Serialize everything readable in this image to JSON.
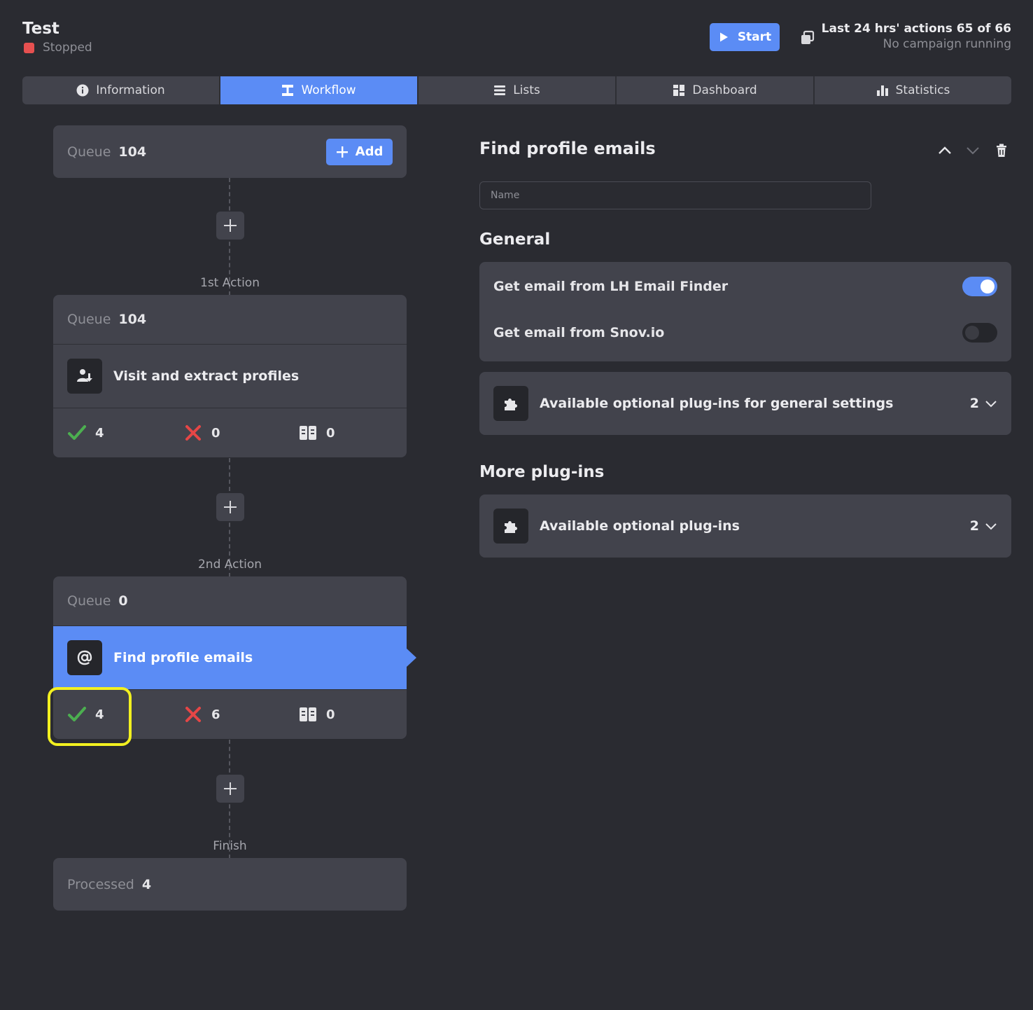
{
  "header": {
    "title": "Test",
    "status": "Stopped",
    "start_label": "Start",
    "actions_line": "Last 24 hrs' actions 65 of 66",
    "campaign_line": "No campaign running"
  },
  "tabs": [
    {
      "label": "Information",
      "icon": "info-icon"
    },
    {
      "label": "Workflow",
      "icon": "workflow-icon",
      "active": true
    },
    {
      "label": "Lists",
      "icon": "list-icon"
    },
    {
      "label": "Dashboard",
      "icon": "dashboard-icon"
    },
    {
      "label": "Statistics",
      "icon": "bar-chart-icon"
    }
  ],
  "workflow": {
    "start": {
      "queue_label": "Queue",
      "queue_count": "104",
      "add_label": "Add"
    },
    "steps": [
      {
        "label": "1st Action",
        "queue_label": "Queue",
        "queue_count": "104",
        "action": "Visit and extract profiles",
        "icon": "user-download-icon",
        "success": "4",
        "failed": "0",
        "skipped": "0"
      },
      {
        "label": "2nd Action",
        "queue_label": "Queue",
        "queue_count": "0",
        "action": "Find profile emails",
        "icon": "at-sign-icon",
        "success": "4",
        "failed": "6",
        "skipped": "0",
        "selected": true
      }
    ],
    "finish": {
      "label": "Finish",
      "processed_label": "Processed",
      "processed_count": "4"
    }
  },
  "panel": {
    "title": "Find profile emails",
    "name_placeholder": "Name",
    "general_heading": "General",
    "toggles": [
      {
        "label": "Get email from LH Email Finder",
        "on": true
      },
      {
        "label": "Get email from Snov.io",
        "on": false
      }
    ],
    "general_plugins": {
      "label": "Available optional plug-ins for general settings",
      "count": "2"
    },
    "more_heading": "More plug-ins",
    "more_plugins": {
      "label": "Available optional plug-ins",
      "count": "2"
    }
  },
  "colors": {
    "accent": "#5b8cf5",
    "success": "#4caf50",
    "danger": "#e64646",
    "highlight": "#f2f020",
    "background": "#2a2b31",
    "card": "#42434c"
  }
}
